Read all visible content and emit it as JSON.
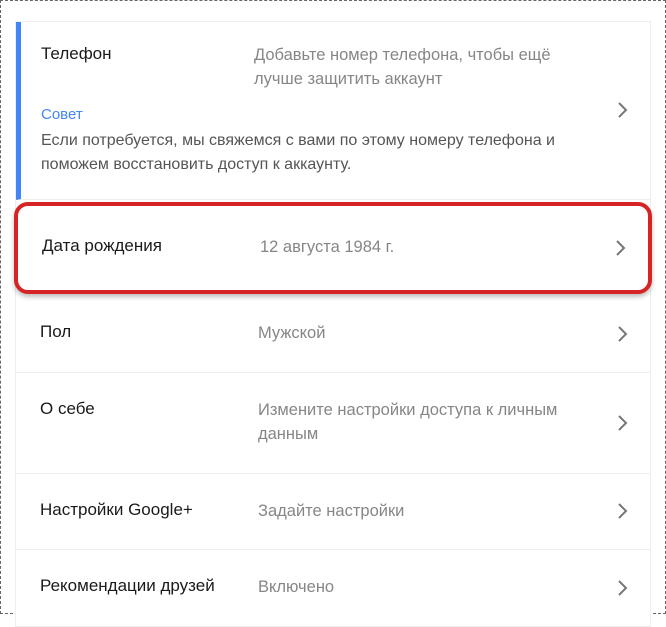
{
  "phone": {
    "label": "Телефон",
    "value": "Добавьте номер телефона, чтобы ещё лучше защитить аккаунт",
    "tip_label": "Совет",
    "tip_text": "Если потребуется, мы свяжемся с вами по этому номеру телефона и поможем восстановить доступ к аккаунту."
  },
  "birthday": {
    "label": "Дата рождения",
    "value": "12 августа 1984 г."
  },
  "gender": {
    "label": "Пол",
    "value": "Мужской"
  },
  "about": {
    "label": "О себе",
    "value": "Измените настройки доступа к личным данным"
  },
  "gplus": {
    "label": "Настройки Google+",
    "value": "Задайте настройки"
  },
  "friends": {
    "label": "Рекомендации друзей",
    "value": "Включено"
  }
}
